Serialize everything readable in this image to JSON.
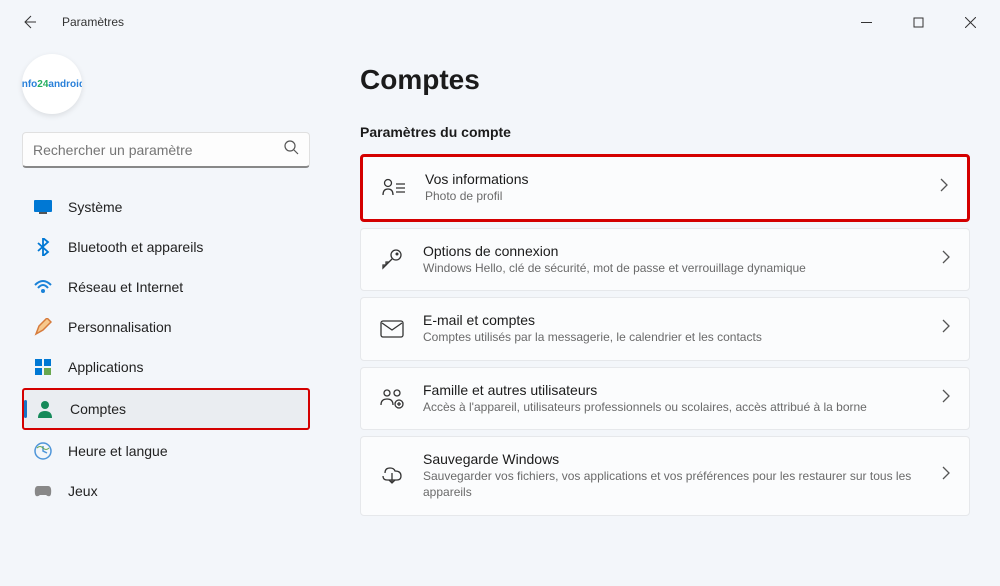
{
  "window": {
    "title": "Paramètres"
  },
  "search": {
    "placeholder": "Rechercher un paramètre"
  },
  "avatar": {
    "logo_text1": "Info",
    "logo_text2": "24",
    "logo_text3": "android"
  },
  "sidebar": {
    "items": [
      {
        "id": "system",
        "label": "Système"
      },
      {
        "id": "bluetooth",
        "label": "Bluetooth et appareils"
      },
      {
        "id": "network",
        "label": "Réseau et Internet"
      },
      {
        "id": "personalization",
        "label": "Personnalisation"
      },
      {
        "id": "apps",
        "label": "Applications"
      },
      {
        "id": "accounts",
        "label": "Comptes"
      },
      {
        "id": "time",
        "label": "Heure et langue"
      },
      {
        "id": "gaming",
        "label": "Jeux"
      }
    ]
  },
  "main": {
    "page_title": "Comptes",
    "section_title": "Paramètres du compte",
    "cards": [
      {
        "id": "your-info",
        "title": "Vos informations",
        "desc": "Photo de profil"
      },
      {
        "id": "signin-options",
        "title": "Options de connexion",
        "desc": "Windows Hello, clé de sécurité, mot de passe et verrouillage dynamique"
      },
      {
        "id": "email-accounts",
        "title": "E-mail et comptes",
        "desc": "Comptes utilisés par la messagerie, le calendrier et les contacts"
      },
      {
        "id": "family",
        "title": "Famille et autres utilisateurs",
        "desc": "Accès à l'appareil, utilisateurs professionnels ou scolaires, accès attribué à la borne"
      },
      {
        "id": "backup",
        "title": "Sauvegarde Windows",
        "desc": "Sauvegarder vos fichiers, vos applications et vos préférences pour les restaurer sur tous les appareils"
      }
    ]
  }
}
